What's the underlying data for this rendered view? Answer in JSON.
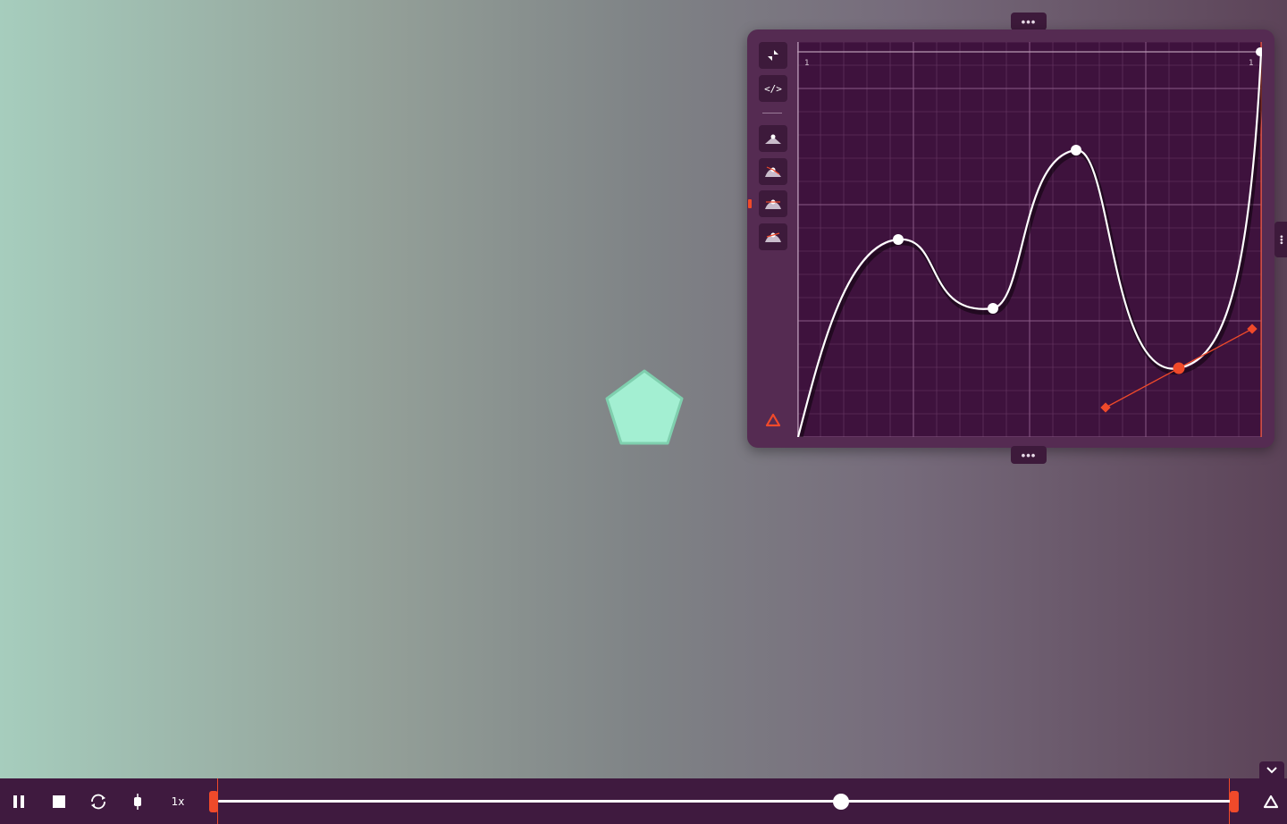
{
  "canvas": {
    "shape": "pentagon",
    "fill": "#a3efd2",
    "stroke": "#7fcfae"
  },
  "editor": {
    "grip_top": "•••",
    "grip_bottom": "•••",
    "grip_right": "•••",
    "tools": [
      {
        "icon": "collapse-arrows-icon",
        "label": ""
      },
      {
        "icon": "code-icon",
        "label": "</>"
      },
      {
        "icon": "point-corner-icon",
        "label": ""
      },
      {
        "icon": "point-broken-icon",
        "label": ""
      },
      {
        "icon": "point-mirrored-icon",
        "label": ""
      },
      {
        "icon": "point-aligned-icon",
        "label": ""
      }
    ],
    "brand_icon": "triangle-logo-icon",
    "graph": {
      "top_left_label": "1",
      "top_right_label": "1",
      "curve_color": "#ffffff",
      "selection_color": "#f04a2a",
      "background": "#3e123d"
    }
  },
  "player": {
    "pause_icon": "pause-icon",
    "stop_icon": "stop-icon",
    "loop_icon": "loop-icon",
    "keyframe_icon": "keyframe-icon",
    "speed": "1x",
    "progress": 0.615,
    "logo_icon": "triangle-logo-icon",
    "collapse_icon": "chevron-down-icon"
  },
  "colors": {
    "accent": "#f04a2a",
    "panel": "#552b52",
    "panel_dark": "#3d1a3b",
    "bar": "#3f1a3f"
  }
}
